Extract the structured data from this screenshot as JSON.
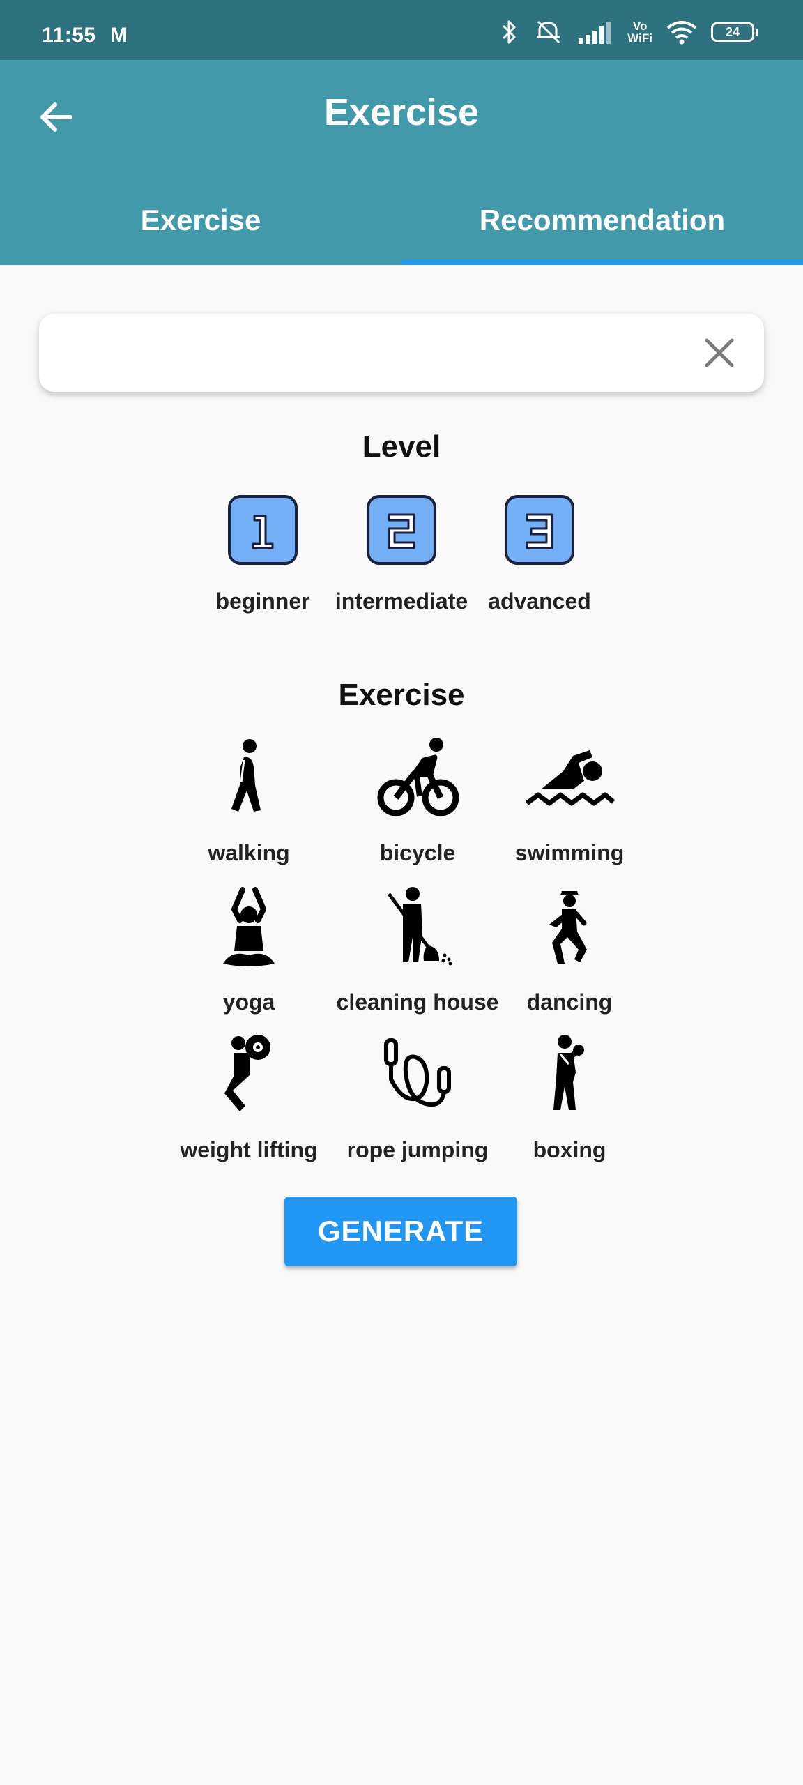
{
  "status_bar": {
    "time": "11:55",
    "carrier_icon": "M",
    "vowifi": [
      "Vo",
      "WiFi"
    ],
    "battery": "24"
  },
  "app_bar": {
    "title": "Exercise",
    "tabs": [
      {
        "label": "Exercise",
        "active": false
      },
      {
        "label": "Recommendation",
        "active": true
      }
    ]
  },
  "search": {
    "value": "",
    "placeholder": ""
  },
  "level_section": {
    "title": "Level",
    "levels": [
      {
        "number": "1",
        "label": "beginner"
      },
      {
        "number": "2",
        "label": "intermediate"
      },
      {
        "number": "3",
        "label": "advanced"
      }
    ]
  },
  "exercise_section": {
    "title": "Exercise",
    "items": [
      {
        "label": "walking",
        "icon": "walking-icon"
      },
      {
        "label": "bicycle",
        "icon": "bicycle-icon"
      },
      {
        "label": "swimming",
        "icon": "swimming-icon"
      },
      {
        "label": "yoga",
        "icon": "yoga-icon"
      },
      {
        "label": "cleaning house",
        "icon": "cleaning-icon"
      },
      {
        "label": "dancing",
        "icon": "dancing-icon"
      },
      {
        "label": "weight lifting",
        "icon": "weight-lifting-icon"
      },
      {
        "label": "rope jumping",
        "icon": "rope-jumping-icon"
      },
      {
        "label": "boxing",
        "icon": "boxing-icon"
      }
    ]
  },
  "generate_button": {
    "label": "GENERATE"
  },
  "colors": {
    "status_bar": "#2f727f",
    "app_bar": "#4199aa",
    "accent": "#2196f3",
    "level_badge": "#74aef4",
    "background": "#f9f9f9"
  }
}
